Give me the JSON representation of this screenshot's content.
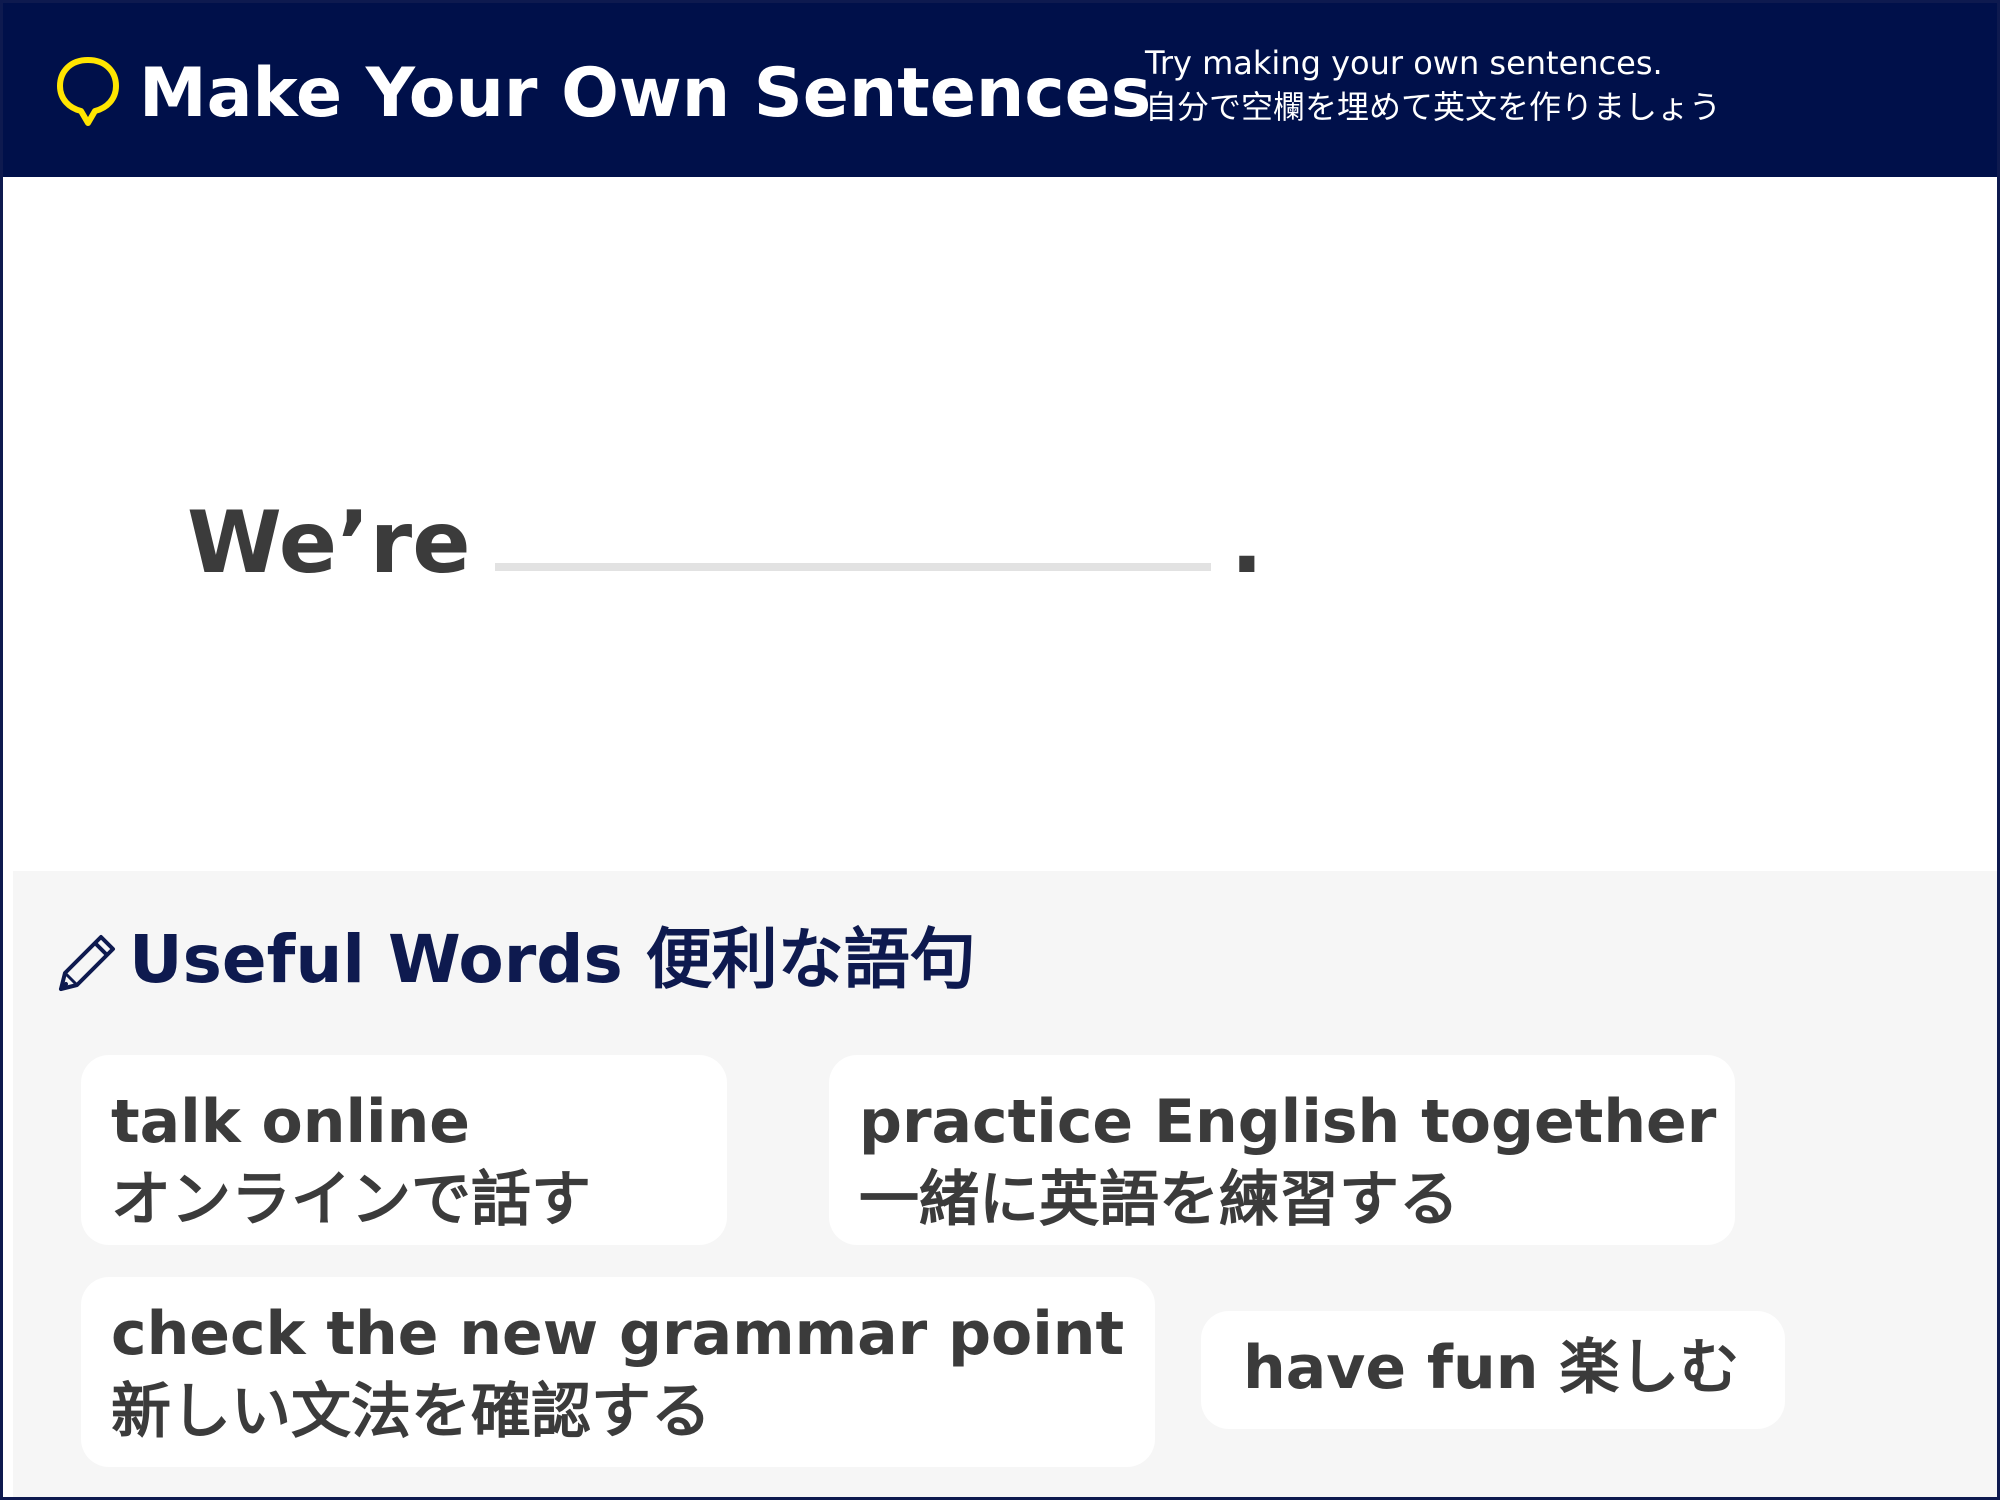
{
  "header": {
    "title": "Make Your Own Sentences",
    "subtitle_en": "Try making your own sentences.",
    "subtitle_ja": "自分で空欄を埋めて英文を作りましょう",
    "icon": "speech-bubble-icon",
    "background_color": "#00104a",
    "icon_color": "#ffe500"
  },
  "sentence": {
    "lead": "We’re",
    "end": "."
  },
  "useful_words": {
    "heading": "Useful Words 便利な語句",
    "icon": "pencil-icon",
    "items": [
      {
        "en": "talk online",
        "ja": "オンラインで話す"
      },
      {
        "en": "practice English together",
        "ja": "一緒に英語を練習する"
      },
      {
        "en": "check the new grammar point",
        "ja": "新しい文法を確認する"
      },
      {
        "en": "have fun",
        "ja": "楽しむ"
      }
    ]
  }
}
